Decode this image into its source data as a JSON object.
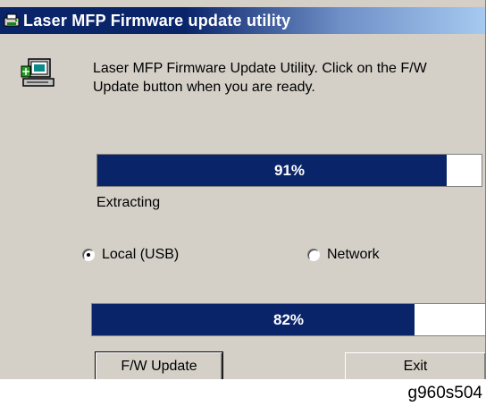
{
  "window": {
    "title": "Laser MFP Firmware update utility",
    "title_icon": "printer-app-icon"
  },
  "intro": {
    "icon": "firmware-update-icon",
    "text": "Laser MFP Firmware Update Utility. Click on the F/W Update button when you are ready."
  },
  "progress_top": {
    "label": "91%",
    "fraction": 0.91
  },
  "status": {
    "text": "Extracting"
  },
  "connection": {
    "options": [
      {
        "label": "Local (USB)",
        "selected": true
      },
      {
        "label": "Network",
        "selected": false
      }
    ]
  },
  "progress_bottom": {
    "label": "82%",
    "fraction": 0.82
  },
  "buttons": {
    "fw_update": "F/W Update",
    "exit": "Exit"
  },
  "caption": "g960s504",
  "colors": {
    "title_bar": "#0a246a",
    "progress_fill": "#0a246a",
    "window_face": "#d4d0c8"
  }
}
